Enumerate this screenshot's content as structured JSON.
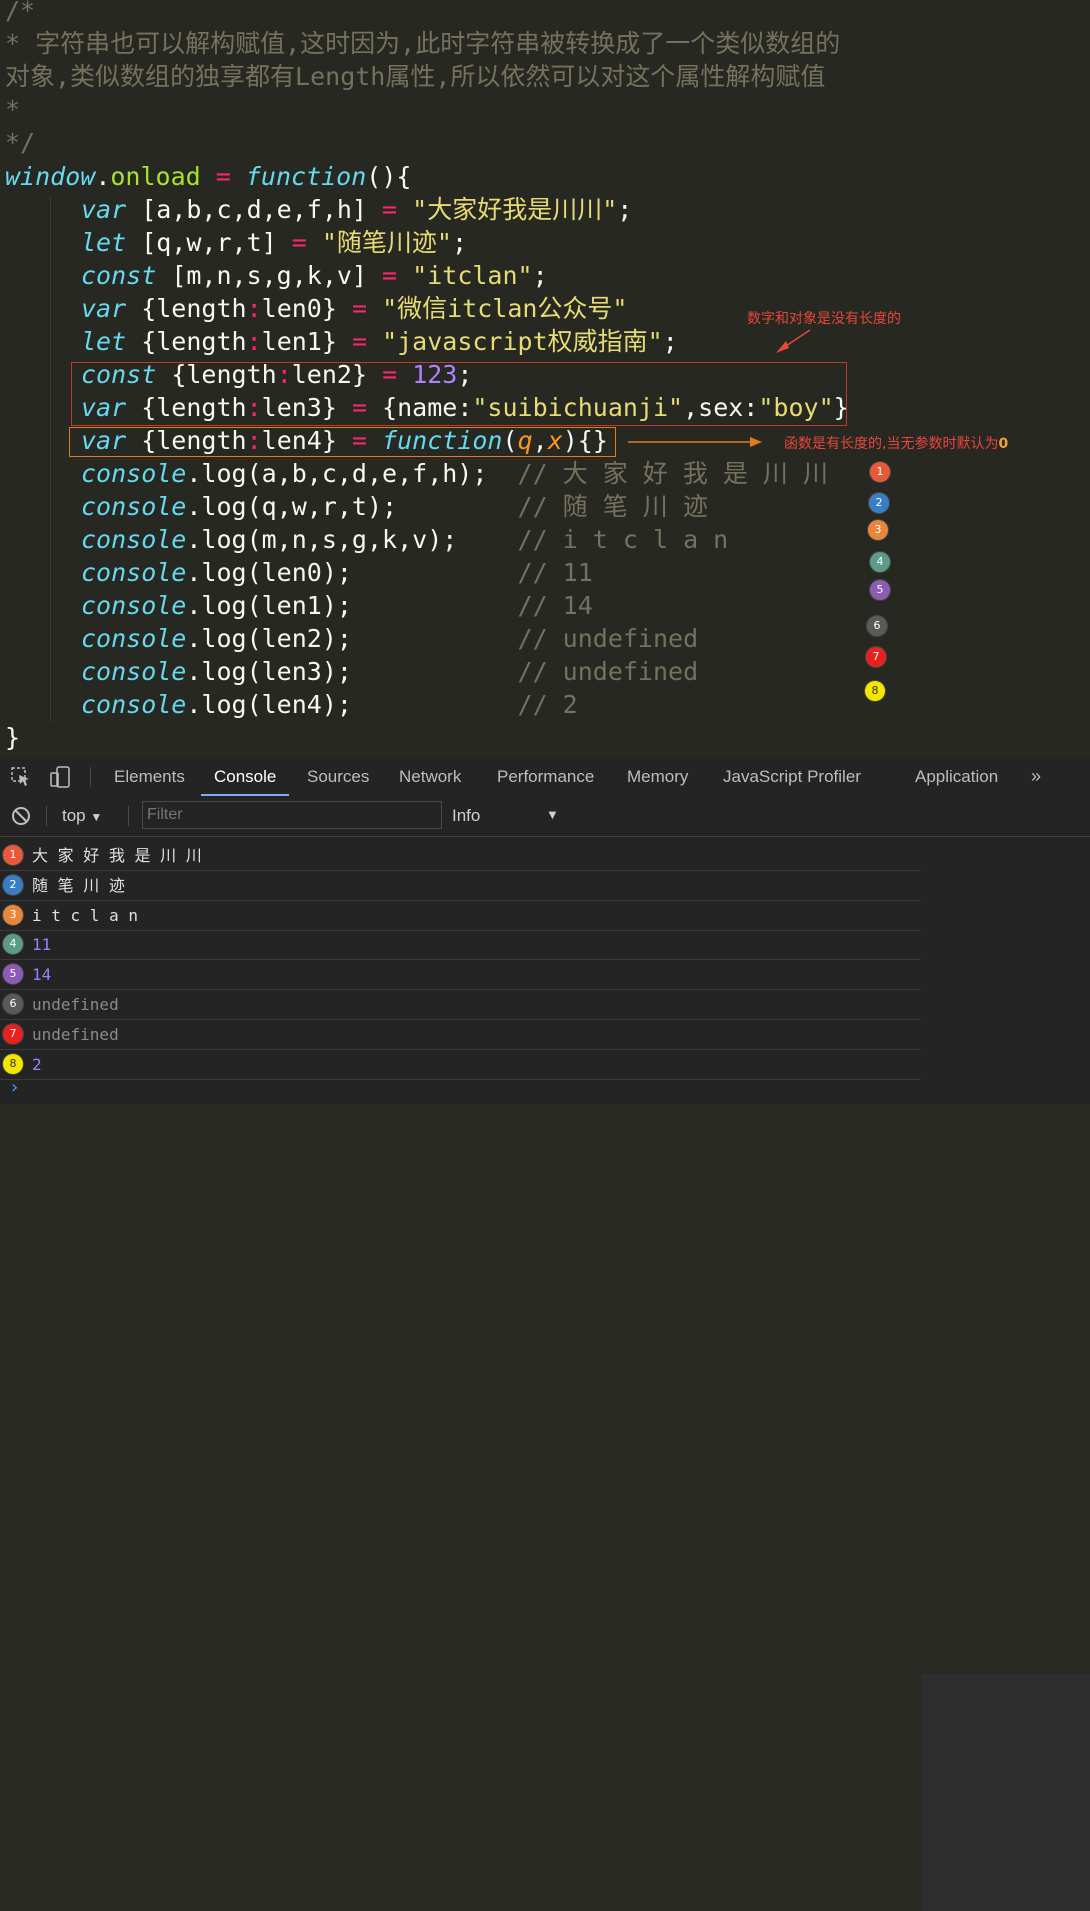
{
  "code": {
    "c1": "/*",
    "c2": "* 字符串也可以解构赋值,这时因为,此时字符串被转换成了一个类似数组的",
    "c3": "对象,类似数组的独享都有Length属性,所以依然可以对这个属性解构赋值",
    "c4": "*",
    "c5": "*/",
    "window": "window",
    "onload": "onload",
    "function": "function",
    "kw_var": "var",
    "kw_let": "let",
    "kw_const": "const",
    "str1": "\"大家好我是川川\"",
    "str2": "\"随笔川迹\"",
    "str3": "\"itclan\"",
    "str4": "\"微信itclan公众号\"",
    "str5": "\"javascript权威指南\"",
    "num123": "123",
    "name_str": "\"suibichuanji\"",
    "sex_str": "\"boy\"",
    "p_q": "q",
    "p_x": "x",
    "console": "console",
    "log": "log",
    "cm1": "// 大 家 好 我 是 川 川",
    "cm2": "// 随 笔 川 迹",
    "cm3": "// i t c l a n",
    "cm4": "// 11",
    "cm5": "// 14",
    "cm6": "// undefined",
    "cm7": "// undefined",
    "cm8": "// 2"
  },
  "annotations": {
    "no_length": "数字和对象是没有长度的",
    "function_length": "函数是有长度的,当无参数时默认为",
    "zero": "0"
  },
  "markers": [
    "1",
    "2",
    "3",
    "4",
    "5",
    "6",
    "7",
    "8"
  ],
  "marker_colors": [
    "#e8593c",
    "#3b7dc4",
    "#e8863c",
    "#5b9b8a",
    "#8e5bb4",
    "#5a5a5a",
    "#e82020",
    "#f5e600"
  ],
  "devtools": {
    "tabs": [
      "Elements",
      "Console",
      "Sources",
      "Network",
      "Performance",
      "Memory",
      "JavaScript Profiler",
      "Application"
    ],
    "active_tab": "Console",
    "context": "top",
    "filter_placeholder": "Filter",
    "level": "Info"
  },
  "console_output": [
    {
      "marker": "1",
      "text": "大 家 好 我 是 川 川",
      "color": "#e0e0e0"
    },
    {
      "marker": "2",
      "text": "随 笔 川 迹",
      "color": "#e0e0e0"
    },
    {
      "marker": "3",
      "text": "i t c l a n",
      "color": "#e0e0e0"
    },
    {
      "marker": "4",
      "text": "11",
      "color": "#9980ff"
    },
    {
      "marker": "5",
      "text": "14",
      "color": "#9980ff"
    },
    {
      "marker": "6",
      "text": "undefined",
      "color": "#8a8a8a"
    },
    {
      "marker": "7",
      "text": "undefined",
      "color": "#8a8a8a"
    },
    {
      "marker": "8",
      "text": "2",
      "color": "#9980ff"
    }
  ],
  "prompt": "›"
}
